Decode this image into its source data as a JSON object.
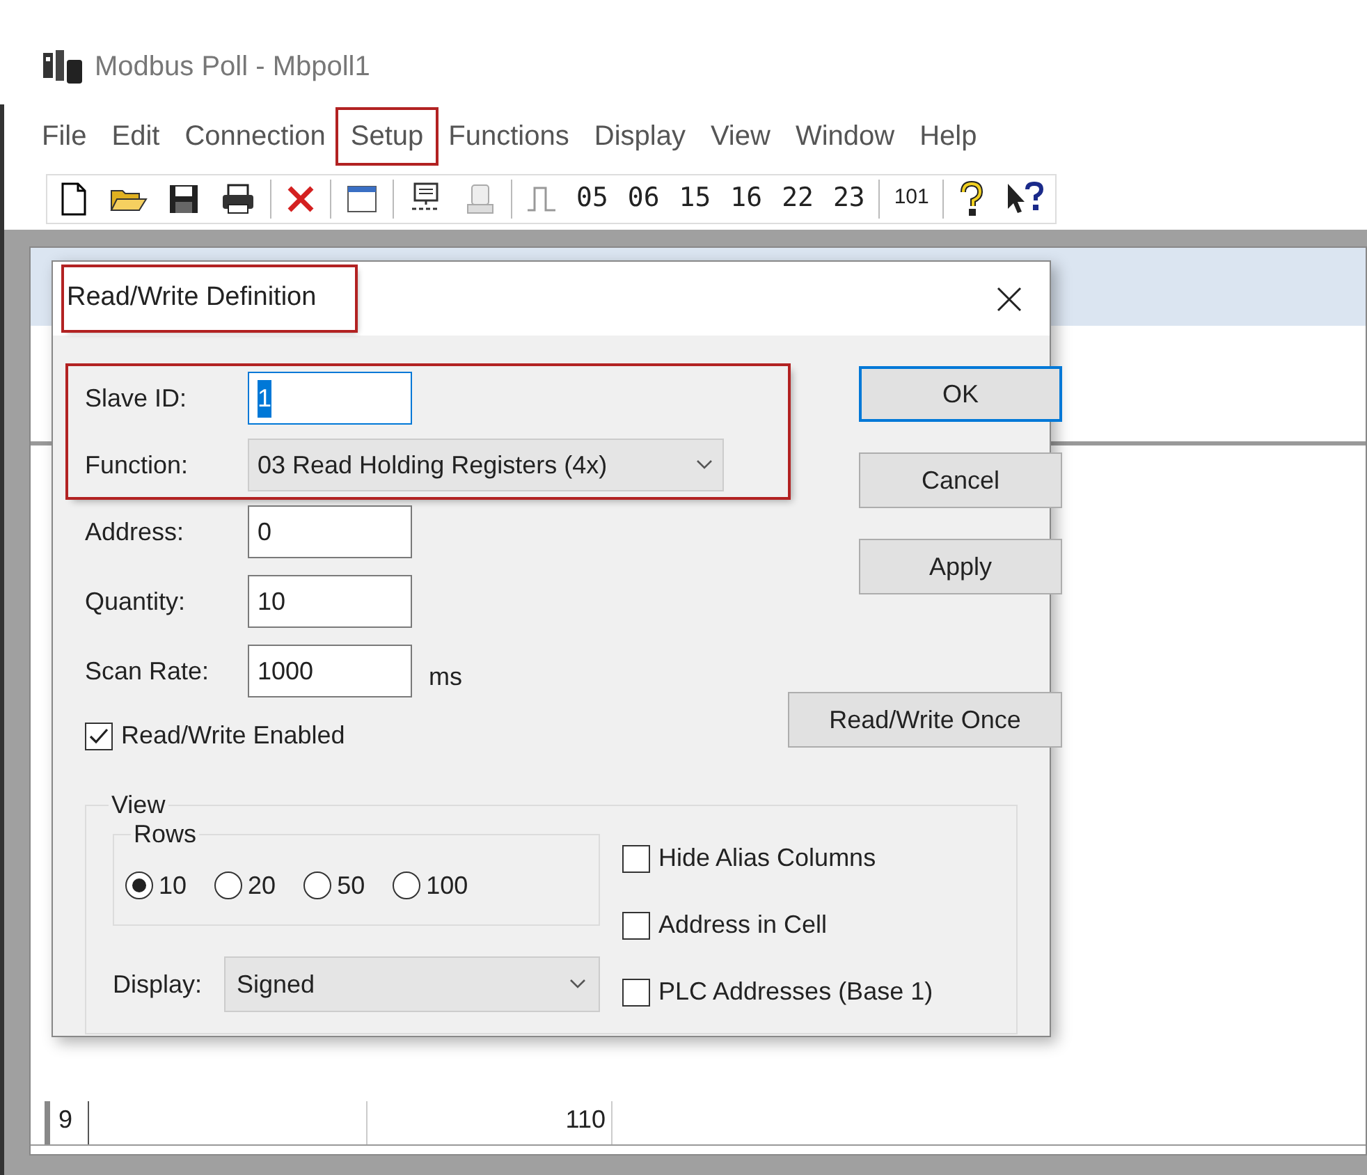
{
  "window": {
    "title": "Modbus Poll - Mbpoll1"
  },
  "menu": [
    {
      "label": "File",
      "highlighted": false
    },
    {
      "label": "Edit",
      "highlighted": false
    },
    {
      "label": "Connection",
      "highlighted": false
    },
    {
      "label": "Setup",
      "highlighted": true
    },
    {
      "label": "Functions",
      "highlighted": false
    },
    {
      "label": "Display",
      "highlighted": false
    },
    {
      "label": "View",
      "highlighted": false
    },
    {
      "label": "Window",
      "highlighted": false
    },
    {
      "label": "Help",
      "highlighted": false
    }
  ],
  "toolbar": {
    "function_codes": [
      "05",
      "06",
      "15",
      "16",
      "22",
      "23"
    ],
    "extra": "101"
  },
  "grid": {
    "row_label": "9",
    "value": "110"
  },
  "dialog": {
    "title": "Read/Write Definition",
    "title_highlighted": true,
    "fields_highlighted": true,
    "slave_id": {
      "label": "Slave ID:",
      "value": "1",
      "selected": true
    },
    "function": {
      "label": "Function:",
      "value": "03 Read Holding Registers (4x)"
    },
    "address": {
      "label": "Address:",
      "value": "0"
    },
    "quantity": {
      "label": "Quantity:",
      "value": "10"
    },
    "scan_rate": {
      "label": "Scan Rate:",
      "value": "1000",
      "unit": "ms"
    },
    "enabled": {
      "label": "Read/Write Enabled",
      "checked": true
    },
    "buttons": [
      {
        "label": "OK",
        "default": true
      },
      {
        "label": "Cancel",
        "default": false
      },
      {
        "label": "Apply",
        "default": false
      }
    ],
    "once_button": "Read/Write Once",
    "view": {
      "legend": "View",
      "rows_legend": "Rows",
      "rows": [
        {
          "label": "10",
          "selected": true
        },
        {
          "label": "20",
          "selected": false
        },
        {
          "label": "50",
          "selected": false
        },
        {
          "label": "100",
          "selected": false
        }
      ],
      "display": {
        "label": "Display:",
        "value": "Signed"
      },
      "options": [
        {
          "label": "Hide Alias Columns",
          "checked": false
        },
        {
          "label": "Address in Cell",
          "checked": false
        },
        {
          "label": "PLC Addresses (Base 1)",
          "checked": false
        }
      ]
    }
  }
}
